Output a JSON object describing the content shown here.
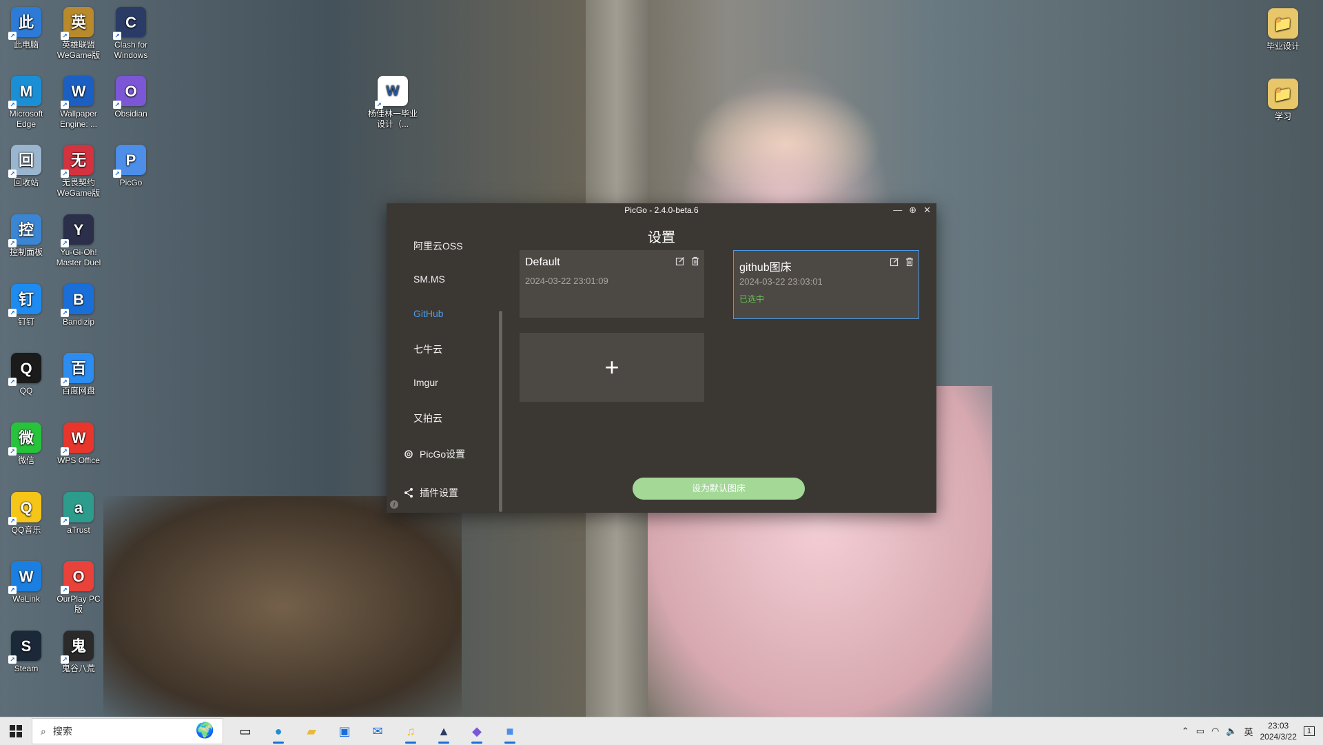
{
  "desktop": {
    "left_icons": [
      {
        "label": "此电脑",
        "icon": "computer-icon",
        "color": "#2d7bd6"
      },
      {
        "label": "英雄联盟 WeGame版",
        "icon": "lol-icon",
        "color": "#b88a2c"
      },
      {
        "label": "Clash for Windows",
        "icon": "clash-cat-icon",
        "color": "#2a3b66"
      },
      {
        "label": "Microsoft Edge",
        "icon": "edge-icon",
        "color": "#1b8fd6"
      },
      {
        "label": "Wallpaper Engine: ...",
        "icon": "wallpaper-engine-icon",
        "color": "#1c5fc2"
      },
      {
        "label": "Obsidian",
        "icon": "obsidian-icon",
        "color": "#7b57d6"
      },
      {
        "label": "回收站",
        "icon": "recycle-bin-icon",
        "color": "#9ab6cf"
      },
      {
        "label": "无畏契约 WeGame版",
        "icon": "valorant-icon",
        "color": "#d3323f"
      },
      {
        "label": "PicGo",
        "icon": "picgo-icon",
        "color": "#4c8ee8"
      },
      {
        "label": "控制面板",
        "icon": "control-panel-icon",
        "color": "#3a86d4"
      },
      {
        "label": "Yu-Gi-Oh! Master Duel",
        "icon": "yugioh-icon",
        "color": "#2b2f4a"
      },
      {
        "label": "钉钉",
        "icon": "dingtalk-icon",
        "color": "#1e8bf0"
      },
      {
        "label": "Bandizip",
        "icon": "bandizip-icon",
        "color": "#1a6ed8"
      },
      {
        "label": "QQ",
        "icon": "qq-icon",
        "color": "#1b1b1b"
      },
      {
        "label": "百度网盘",
        "icon": "baidu-netdisk-icon",
        "color": "#2d8cf0"
      },
      {
        "label": "微信",
        "icon": "wechat-icon",
        "color": "#27c33a"
      },
      {
        "label": "WPS Office",
        "icon": "wps-icon",
        "color": "#e8362d"
      },
      {
        "label": "QQ音乐",
        "icon": "qq-music-icon",
        "color": "#f5c518"
      },
      {
        "label": "aTrust",
        "icon": "atrust-icon",
        "color": "#2d9c8c"
      },
      {
        "label": "WeLink",
        "icon": "welink-icon",
        "color": "#1a7fe0"
      },
      {
        "label": "OurPlay PC 版",
        "icon": "ourplay-icon",
        "color": "#e8423a"
      },
      {
        "label": "Steam",
        "icon": "steam-icon",
        "color": "#1b2838"
      },
      {
        "label": "鬼谷八荒",
        "icon": "guigu-icon",
        "color": "#2a2a2a"
      }
    ],
    "doc_icon": {
      "label": "杨佳林一毕业设计（...",
      "icon": "word-doc-icon",
      "color": "#2b579a"
    },
    "right_icons": [
      {
        "label": "毕业设计",
        "icon": "folder-icon",
        "color": "#e8c66a"
      },
      {
        "label": "学习",
        "icon": "folder-icon",
        "color": "#e8c66a"
      }
    ]
  },
  "window": {
    "title": "PicGo - 2.4.0-beta.6",
    "page_title": "设置",
    "nav": [
      {
        "label": "阿里云OSS",
        "active": false
      },
      {
        "label": "SM.MS",
        "active": false
      },
      {
        "label": "GitHub",
        "active": true
      },
      {
        "label": "七牛云",
        "active": false
      },
      {
        "label": "Imgur",
        "active": false
      },
      {
        "label": "又拍云",
        "active": false
      }
    ],
    "picgo_settings_label": "PicGo设置",
    "plugin_settings_label": "插件设置",
    "cards": [
      {
        "name": "Default",
        "date": "2024-03-22 23:01:09",
        "selected": false,
        "selected_label": ""
      },
      {
        "name": "github图床",
        "date": "2024-03-22 23:03:01",
        "selected": true,
        "selected_label": "已选中"
      }
    ],
    "add_label": "+",
    "default_button": "设为默认图床",
    "accent_color": "#4f9be8",
    "button_color": "#a3d897"
  },
  "taskbar": {
    "search_placeholder": "搜索",
    "apps": [
      "task-view-icon",
      "edge-icon",
      "file-explorer-icon",
      "store-icon",
      "mail-icon",
      "qq-music-icon",
      "clash-cat-icon",
      "obsidian-icon",
      "picgo-icon"
    ],
    "ime": "英",
    "time": "23:03",
    "date": "2024/3/22",
    "notification_count": "1"
  }
}
